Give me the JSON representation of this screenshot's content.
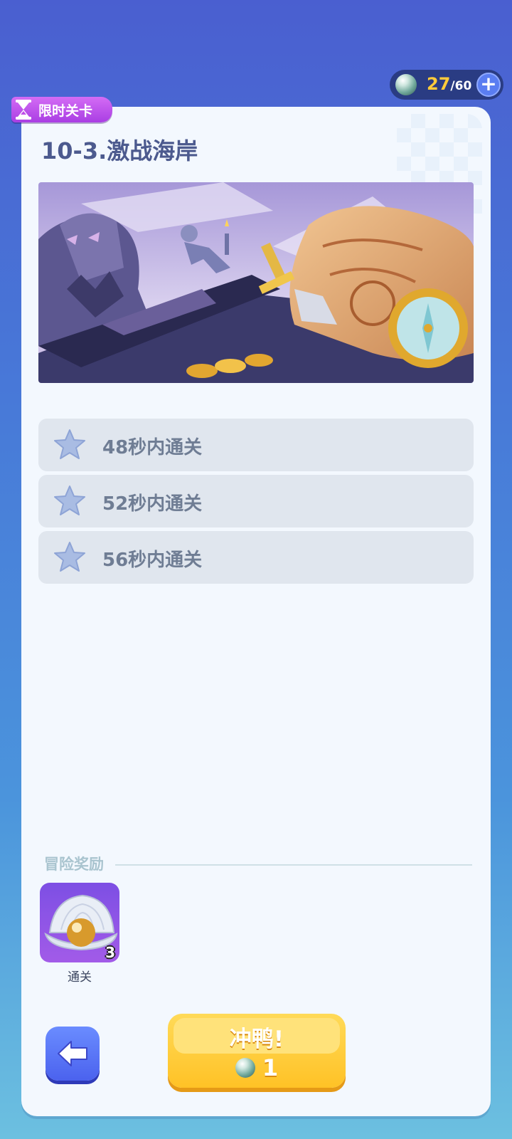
{
  "energy": {
    "current": "27",
    "max": "/60"
  },
  "level": {
    "badge": "限时关卡",
    "title": "10-3.激战海岸"
  },
  "objectives": [
    {
      "text": "48秒内通关"
    },
    {
      "text": "52秒内通关"
    },
    {
      "text": "56秒内通关"
    }
  ],
  "rewards": {
    "heading": "冒险奖励",
    "items": [
      {
        "label": "通关",
        "count": "3",
        "icon": "pearl-shell-icon"
      }
    ]
  },
  "actions": {
    "go_label": "冲鸭!",
    "cost": "1"
  },
  "colors": {
    "accent": "#ffc226",
    "badge": "#b94ae8",
    "back": "#4b62ee"
  }
}
